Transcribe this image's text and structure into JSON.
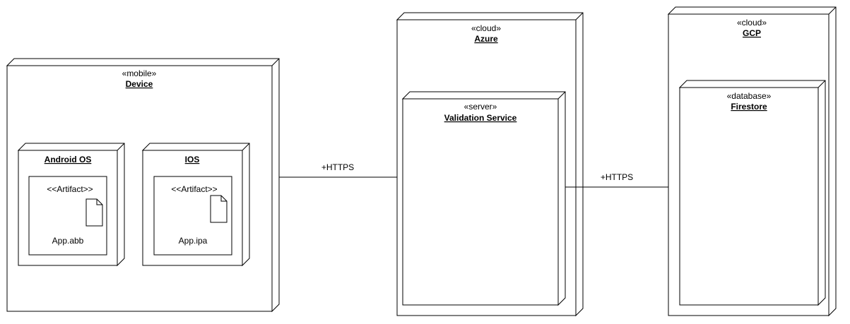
{
  "nodes": {
    "device": {
      "stereotype": "«mobile»",
      "name": "Device"
    },
    "android": {
      "name": "Android OS",
      "artifact": {
        "stereotype": "<<Artifact>>",
        "name": "App.abb"
      }
    },
    "ios": {
      "name": "IOS",
      "artifact": {
        "stereotype": "<<Artifact>>",
        "name": "App.ipa"
      }
    },
    "azure": {
      "stereotype": "«cloud»",
      "name": "Azure"
    },
    "validation": {
      "stereotype": "«server»",
      "name": "Validation Service"
    },
    "gcp": {
      "stereotype": "«cloud»",
      "name": "GCP"
    },
    "firestore": {
      "stereotype": "«database»",
      "name": "Firestore"
    }
  },
  "connections": [
    {
      "from": "Device",
      "to": "Azure",
      "label": "+HTTPS"
    },
    {
      "from": "Validation Service",
      "to": "GCP",
      "label": "+HTTPS"
    }
  ]
}
